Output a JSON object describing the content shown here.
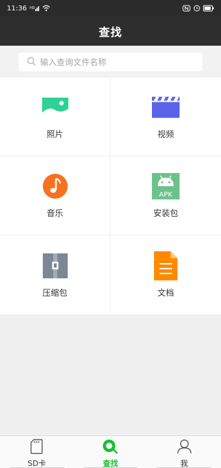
{
  "status_bar": {
    "time": "11:36"
  },
  "header": {
    "title": "查找"
  },
  "search": {
    "placeholder": "输入查询文件名称"
  },
  "categories": [
    {
      "label": "照片",
      "icon": "photo-icon",
      "color": "#2ed296"
    },
    {
      "label": "视频",
      "icon": "video-icon",
      "color": "#5b63e8"
    },
    {
      "label": "音乐",
      "icon": "music-icon",
      "color": "#f6721e"
    },
    {
      "label": "安装包",
      "icon": "android-icon",
      "color": "#6cc28a",
      "icon_text": "APK"
    },
    {
      "label": "压缩包",
      "icon": "zip-icon",
      "color": "#7d8793"
    },
    {
      "label": "文档",
      "icon": "document-icon",
      "color": "#ff8a00"
    }
  ],
  "bottom_nav": [
    {
      "label": "SD卡",
      "icon": "sd-card-icon",
      "active": false
    },
    {
      "label": "查找",
      "icon": "search-icon",
      "active": true
    },
    {
      "label": "我",
      "icon": "person-icon",
      "active": false
    }
  ],
  "colors": {
    "accent": "#18c12e",
    "header_bg": "#2e2e2e"
  }
}
